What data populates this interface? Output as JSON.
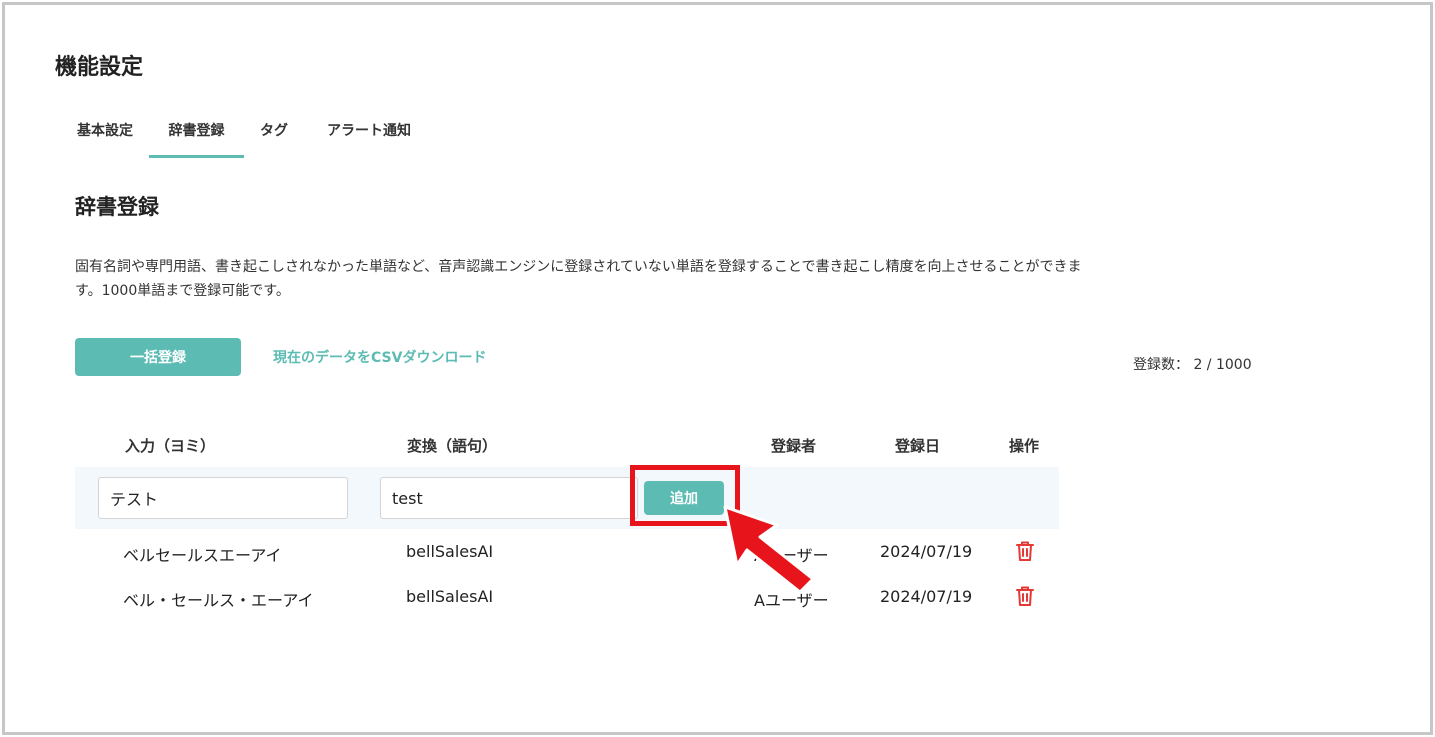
{
  "page": {
    "title": "機能設定"
  },
  "tabs": [
    {
      "label": "基本設定"
    },
    {
      "label": "辞書登録",
      "active": true
    },
    {
      "label": "タグ"
    },
    {
      "label": "アラート通知"
    }
  ],
  "section": {
    "title": "辞書登録",
    "description_line1": "固有名詞や専門用語、書き起こしされなかった単語など、音声認識エンジンに登録されていない単語を登録することで書き起こし精度を向上させることができま",
    "description_line2": "す。1000単語まで登録可能です。"
  },
  "actions": {
    "bulk_label": "一括登録",
    "csv_link": "現在のデータをCSVダウンロード",
    "count_label": "登録数： 2 / 1000"
  },
  "table": {
    "headers": {
      "input": "入力（ヨミ）",
      "conversion": "変換（語句）",
      "registrant": "登録者",
      "date": "登録日",
      "operation": "操作"
    },
    "new_entry": {
      "yomi_value": "テスト",
      "phrase_value": "test",
      "add_label": "追加"
    },
    "rows": [
      {
        "yomi": "ベルセールスエーアイ",
        "phrase": "bellSalesAI",
        "registrant": "Aユーザー",
        "date": "2024/07/19"
      },
      {
        "yomi": "ベル・セールス・エーアイ",
        "phrase": "bellSalesAI",
        "registrant": "Aユーザー",
        "date": "2024/07/19"
      }
    ]
  },
  "colors": {
    "accent": "#5cbcb4",
    "annotation": "#e8141c",
    "delete_icon": "#e53935",
    "input_row_bg": "#f2f8fb"
  },
  "icons": [
    "trash-icon",
    "arrow-annotation-icon"
  ]
}
